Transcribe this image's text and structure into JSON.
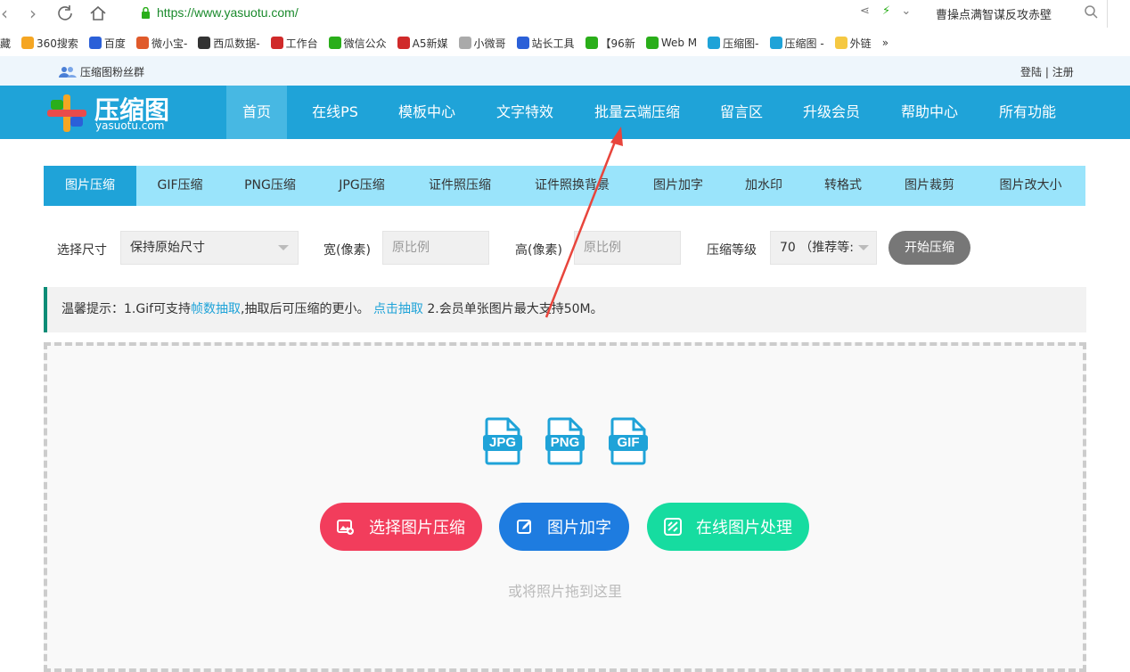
{
  "browser": {
    "url": "https://www.yasuotu.com/",
    "search_hint": "曹操点满智谋反攻赤壁"
  },
  "bookmarks": [
    {
      "label": "藏",
      "icon": "folder-icon"
    },
    {
      "label": "360搜索",
      "icon": "360-icon",
      "color": "#f5a623"
    },
    {
      "label": "百度",
      "icon": "baidu-icon",
      "color": "#2b60d8"
    },
    {
      "label": "微小宝-",
      "icon": "weixiaobao-icon",
      "color": "#e05a2b"
    },
    {
      "label": "西瓜数据-",
      "icon": "xigua-icon",
      "color": "#333333"
    },
    {
      "label": "工作台",
      "icon": "workbench-icon",
      "color": "#d02a2a"
    },
    {
      "label": "微信公众",
      "icon": "wechat-icon",
      "color": "#2aae1a"
    },
    {
      "label": "A5新媒",
      "icon": "a5-icon",
      "color": "#d02a2a"
    },
    {
      "label": "小微哥",
      "icon": "page-icon",
      "color": "#aaaaaa"
    },
    {
      "label": "站长工具",
      "icon": "chinaz-icon",
      "color": "#2b60d8"
    },
    {
      "label": "【96新",
      "icon": "96-icon",
      "color": "#2aae1a"
    },
    {
      "label": "Web M",
      "icon": "96-icon",
      "color": "#2aae1a"
    },
    {
      "label": "压缩图-",
      "icon": "yasuotu-icon",
      "color": "#1fa3d8"
    },
    {
      "label": "压缩图 -",
      "icon": "yasuotu-icon",
      "color": "#1fa3d8"
    },
    {
      "label": "外链",
      "icon": "folder-icon",
      "color": "#f5c842"
    }
  ],
  "topbar": {
    "fans": "压缩图粉丝群",
    "login": "登陆",
    "register": "注册"
  },
  "logo": {
    "name": "压缩图",
    "domain": "yasuotu.com"
  },
  "mainnav": [
    "首页",
    "在线PS",
    "模板中心",
    "文字特效",
    "批量云端压缩",
    "留言区",
    "升级会员",
    "帮助中心",
    "所有功能"
  ],
  "tabs": [
    "图片压缩",
    "GIF压缩",
    "PNG压缩",
    "JPG压缩",
    "证件照压缩",
    "证件照换背景",
    "图片加字",
    "加水印",
    "转格式",
    "图片裁剪",
    "图片改大小"
  ],
  "options": {
    "size_label": "选择尺寸",
    "size_value": "保持原始尺寸",
    "width_label": "宽(像素)",
    "width_placeholder": "原比例",
    "height_label": "高(像素)",
    "height_placeholder": "原比例",
    "level_label": "压缩等级",
    "level_value": "70 （推荐等:",
    "start": "开始压缩"
  },
  "tip": {
    "prefix": "温馨提示：1.Gif可支持",
    "link1": "帧数抽取",
    "middle": ",抽取后可压缩的更小。 ",
    "link2": "点击抽取",
    "suffix": " 2.会员单张图片最大支持50M。"
  },
  "upload": {
    "file_types": [
      "JPG",
      "PNG",
      "GIF"
    ],
    "buttons": [
      {
        "label": "选择图片压缩",
        "color": "#f23d5c"
      },
      {
        "label": "图片加字",
        "color": "#1e7ce0"
      },
      {
        "label": "在线图片处理",
        "color": "#16dca0"
      }
    ],
    "drag_hint": "或将照片拖到这里"
  },
  "colors": {
    "nav": "#1fa3d8",
    "tabs": "#9ae4fb",
    "arrow": "#e8453c"
  }
}
